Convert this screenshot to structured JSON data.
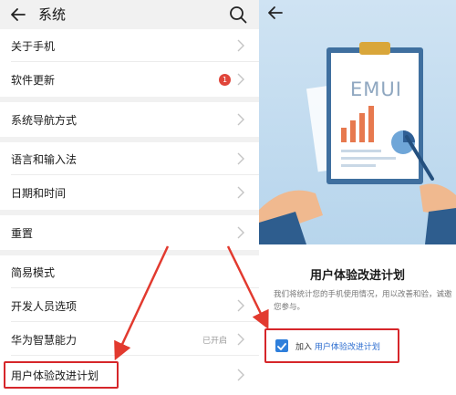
{
  "left": {
    "header": {
      "title": "系统",
      "back_icon": "back-arrow-icon",
      "search_icon": "search-icon"
    },
    "items": [
      {
        "label": "关于手机"
      },
      {
        "label": "软件更新",
        "badge": "1"
      },
      {
        "label": "系统导航方式"
      },
      {
        "label": "语言和输入法"
      },
      {
        "label": "日期和时间"
      },
      {
        "label": "重置"
      },
      {
        "label": "简易模式"
      },
      {
        "label": "开发人员选项"
      },
      {
        "label": "华为智慧能力",
        "state": "已开启"
      },
      {
        "label": "用户体验改进计划"
      }
    ]
  },
  "right": {
    "back_icon": "back-arrow-icon",
    "illustration": {
      "logo_text": "EMUI"
    },
    "title": "用户体验改进计划",
    "description": "我们将统计您的手机使用情况，用以改善和验，诚邀您参与。",
    "checkbox": {
      "checked": true,
      "prefix": "加入",
      "link": "用户体验改进计划"
    }
  },
  "colors": {
    "accent_red": "#d6262a",
    "link_blue": "#2f6fd0",
    "badge_red": "#e0453a"
  }
}
